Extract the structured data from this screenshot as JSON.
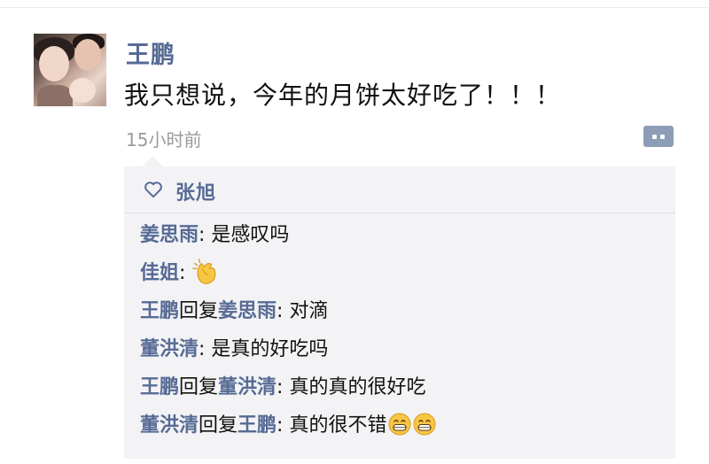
{
  "post": {
    "author": "王鹏",
    "text": "我只想说，今年的月饼太好吃了！！！",
    "time": "15小时前"
  },
  "likes": {
    "names": "张旭",
    "icon": "heart-outline-icon"
  },
  "comments": [
    {
      "author": "姜思雨",
      "text": "是感叹吗"
    },
    {
      "author": "佳姐",
      "text": "",
      "emoji": "clapping-hands-icon"
    },
    {
      "author": "王鹏",
      "reply_word": "回复",
      "reply_to": "姜思雨",
      "text": "对滴"
    },
    {
      "author": "董洪清",
      "text": "是真的好吃吗"
    },
    {
      "author": "王鹏",
      "reply_word": "回复",
      "reply_to": "董洪清",
      "text": "真的真的很好吃"
    },
    {
      "author": "董洪清",
      "reply_word": "回复",
      "reply_to": "王鹏",
      "text": "真的很不错",
      "emoji": "grinning-face-icon"
    }
  ],
  "colors": {
    "nickname": "#576b95",
    "panel_bg": "#f3f3f5",
    "timestamp": "#9a9a9a",
    "more_button": "#8d9db8"
  }
}
